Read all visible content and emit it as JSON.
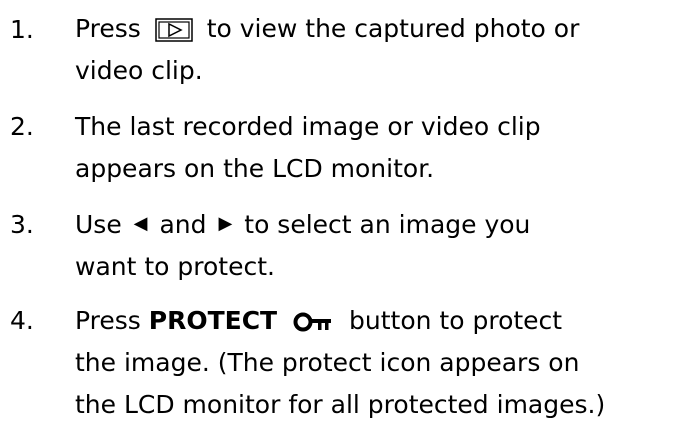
{
  "steps": [
    {
      "number": "1.",
      "line1_before_icon": "Press",
      "line1_after_icon": "to view the captured photo or",
      "line2": "video clip.",
      "icon": "playback-button-icon"
    },
    {
      "number": "2.",
      "line1": "The last recorded image or video clip",
      "line2": "appears on the LCD monitor."
    },
    {
      "number": "3.",
      "line1_a": "Use",
      "line1_b": "and",
      "line1_c": "to select an image you",
      "line2": "want to protect.",
      "icons": [
        "left-arrow-icon",
        "right-arrow-icon"
      ]
    },
    {
      "number": "4.",
      "line1_before": "Press",
      "line1_bold": "PROTECT",
      "line1_after": "button to protect",
      "line2": "the image. (The protect icon appears on",
      "line3": "the LCD monitor for all protected images.)",
      "icon": "protect-key-icon"
    }
  ]
}
